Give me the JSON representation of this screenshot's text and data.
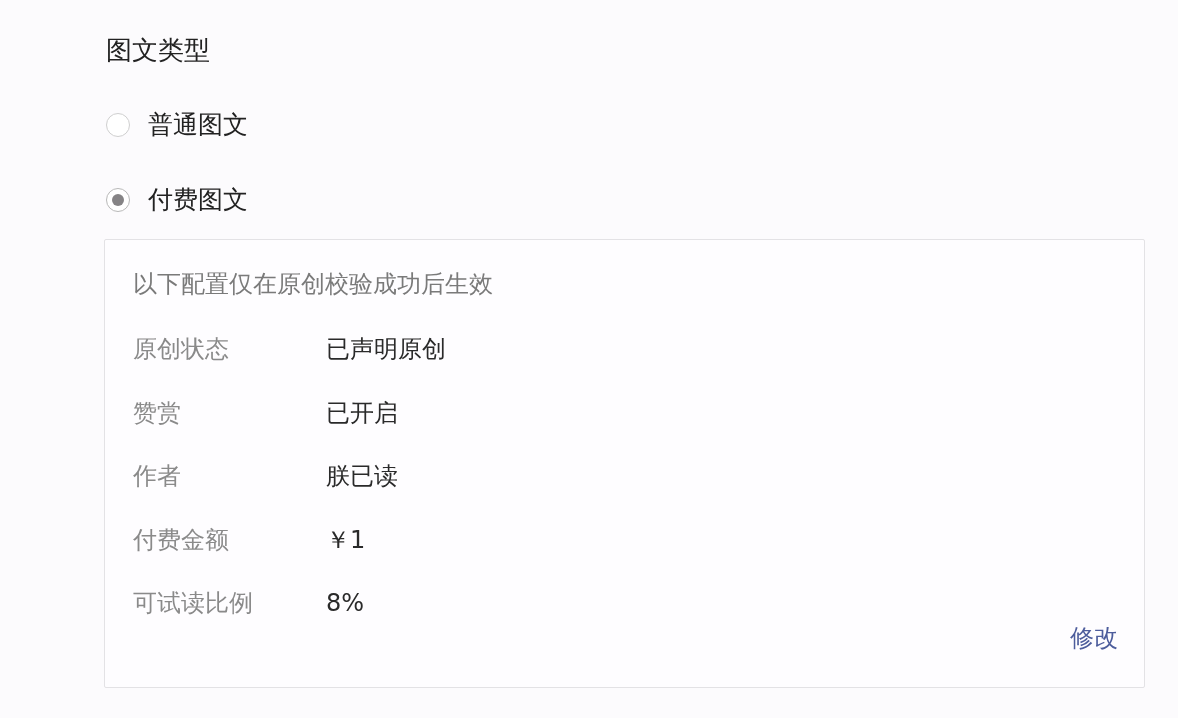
{
  "section": {
    "title": "图文类型"
  },
  "type_options": [
    {
      "label": "普通图文",
      "selected": false
    },
    {
      "label": "付费图文",
      "selected": true
    }
  ],
  "paid_settings": {
    "note": "以下配置仅在原创校验成功后生效",
    "fields": [
      {
        "label": "原创状态",
        "value": "已声明原创"
      },
      {
        "label": "赞赏",
        "value": "已开启"
      },
      {
        "label": "作者",
        "value": "朕已读"
      },
      {
        "label": "付费金额",
        "value": "￥1"
      },
      {
        "label": "可试读比例",
        "value": "8%"
      }
    ],
    "edit_link": "修改"
  }
}
